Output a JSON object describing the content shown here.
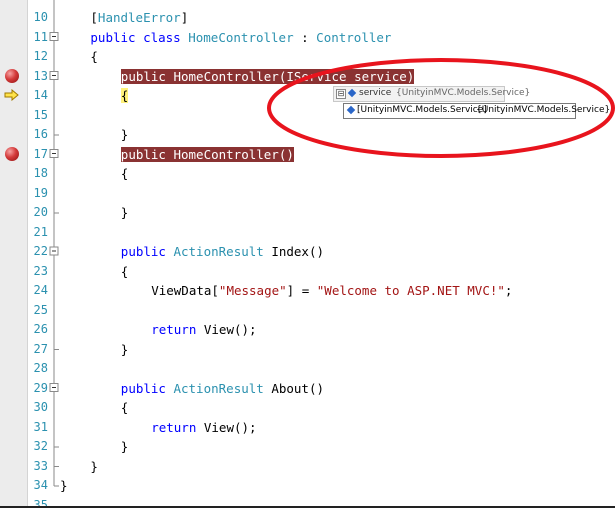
{
  "editor": {
    "lines": [
      {
        "n": "10",
        "parts": [
          {
            "t": "[",
            "c": "tx"
          },
          {
            "t": "HandleError",
            "c": "attr"
          },
          {
            "t": "]",
            "c": "tx"
          }
        ],
        "indent": 4
      },
      {
        "n": "11",
        "parts": [
          {
            "t": "public class ",
            "c": "kw"
          },
          {
            "t": "HomeController",
            "c": "ty"
          },
          {
            "t": " : ",
            "c": "tx"
          },
          {
            "t": "Controller",
            "c": "ty"
          }
        ],
        "indent": 4
      },
      {
        "n": "12",
        "parts": [
          {
            "t": "{",
            "c": "tx"
          }
        ],
        "indent": 4
      },
      {
        "n": "13",
        "parts": [
          {
            "t": "public HomeController(IService service)",
            "c": "hl"
          }
        ],
        "indent": 8
      },
      {
        "n": "14",
        "parts": [
          {
            "t": "{",
            "c": "hl-y"
          }
        ],
        "indent": 8
      },
      {
        "n": "15",
        "parts": [],
        "indent": 8
      },
      {
        "n": "16",
        "parts": [
          {
            "t": "}",
            "c": "tx"
          }
        ],
        "indent": 8
      },
      {
        "n": "17",
        "parts": [
          {
            "t": "public HomeController()",
            "c": "hl"
          }
        ],
        "indent": 8
      },
      {
        "n": "18",
        "parts": [
          {
            "t": "{",
            "c": "tx"
          }
        ],
        "indent": 8
      },
      {
        "n": "19",
        "parts": [],
        "indent": 8
      },
      {
        "n": "20",
        "parts": [
          {
            "t": "}",
            "c": "tx"
          }
        ],
        "indent": 8
      },
      {
        "n": "21",
        "parts": [],
        "indent": 8
      },
      {
        "n": "22",
        "parts": [
          {
            "t": "public ",
            "c": "kw"
          },
          {
            "t": "ActionResult",
            "c": "ty"
          },
          {
            "t": " Index()",
            "c": "tx"
          }
        ],
        "indent": 8
      },
      {
        "n": "23",
        "parts": [
          {
            "t": "{",
            "c": "tx"
          }
        ],
        "indent": 8
      },
      {
        "n": "24",
        "parts": [
          {
            "t": "ViewData[",
            "c": "tx"
          },
          {
            "t": "\"Message\"",
            "c": "st"
          },
          {
            "t": "] = ",
            "c": "tx"
          },
          {
            "t": "\"Welcome to ASP.NET MVC!\"",
            "c": "st"
          },
          {
            "t": ";",
            "c": "tx"
          }
        ],
        "indent": 12
      },
      {
        "n": "25",
        "parts": [],
        "indent": 12
      },
      {
        "n": "26",
        "parts": [
          {
            "t": "return ",
            "c": "kw"
          },
          {
            "t": "View();",
            "c": "tx"
          }
        ],
        "indent": 12
      },
      {
        "n": "27",
        "parts": [
          {
            "t": "}",
            "c": "tx"
          }
        ],
        "indent": 8
      },
      {
        "n": "28",
        "parts": [],
        "indent": 8
      },
      {
        "n": "29",
        "parts": [
          {
            "t": "public ",
            "c": "kw"
          },
          {
            "t": "ActionResult",
            "c": "ty"
          },
          {
            "t": " About()",
            "c": "tx"
          }
        ],
        "indent": 8
      },
      {
        "n": "30",
        "parts": [
          {
            "t": "{",
            "c": "tx"
          }
        ],
        "indent": 8
      },
      {
        "n": "31",
        "parts": [
          {
            "t": "return ",
            "c": "kw"
          },
          {
            "t": "View();",
            "c": "tx"
          }
        ],
        "indent": 12
      },
      {
        "n": "32",
        "parts": [
          {
            "t": "}",
            "c": "tx"
          }
        ],
        "indent": 8
      },
      {
        "n": "33",
        "parts": [
          {
            "t": "}",
            "c": "tx"
          }
        ],
        "indent": 4
      },
      {
        "n": "34",
        "parts": [
          {
            "t": "}",
            "c": "tx"
          }
        ],
        "indent": 0
      },
      {
        "n": "35",
        "parts": [],
        "indent": 0
      }
    ],
    "breakpoints": [
      "13",
      "17"
    ],
    "current_line": "14",
    "collapse_lines": [
      "11",
      "13",
      "17",
      "22",
      "29"
    ]
  },
  "datatip": {
    "name": "service",
    "value": "{UnityinMVC.Models.Service}",
    "child_name": "[UnityinMVC.Models.Service]",
    "child_value": "{UnityinMVC.Models.Service}",
    "expander": "⊟"
  },
  "annotation": {
    "color": "#e8141d"
  },
  "icons": {
    "breakpoint": "breakpoint-icon",
    "current": "current-statement-arrow-icon",
    "collapse": "collapse-icon",
    "field": "field-icon"
  }
}
